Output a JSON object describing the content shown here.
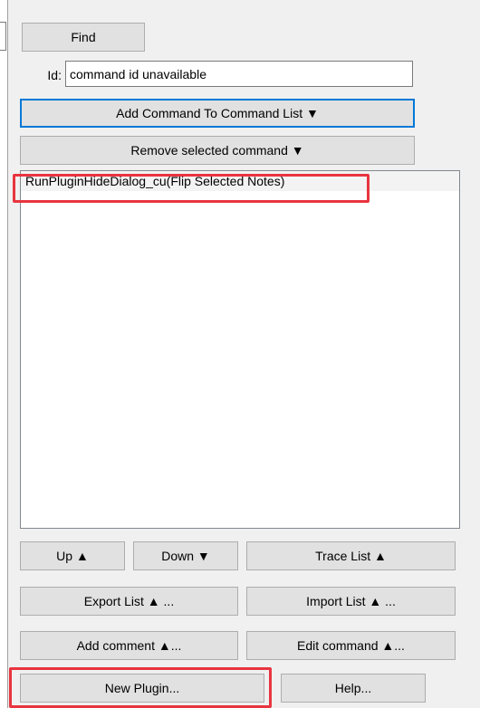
{
  "search": {
    "find_label": "Find"
  },
  "id_field": {
    "label": "Id:",
    "value": "command id unavailable"
  },
  "commands": {
    "add_label": "Add Command To Command List ▼",
    "remove_label": "Remove selected command ▼"
  },
  "command_list": {
    "items": [
      "RunPluginHideDialog_cu(Flip Selected Notes)"
    ]
  },
  "buttons": {
    "up": "Up ▲",
    "down": "Down ▼",
    "trace_list": "Trace List ▲",
    "export_list": "Export List ▲ ...",
    "import_list": "Import List ▲ ...",
    "add_comment": "Add comment ▲...",
    "edit_command": "Edit command ▲...",
    "new_plugin": "New Plugin...",
    "help": "Help..."
  },
  "colors": {
    "panel_bg": "#f0f0f0",
    "button_bg": "#e1e1e1",
    "focus_border": "#0078d7",
    "highlight_red": "#e8353f"
  }
}
